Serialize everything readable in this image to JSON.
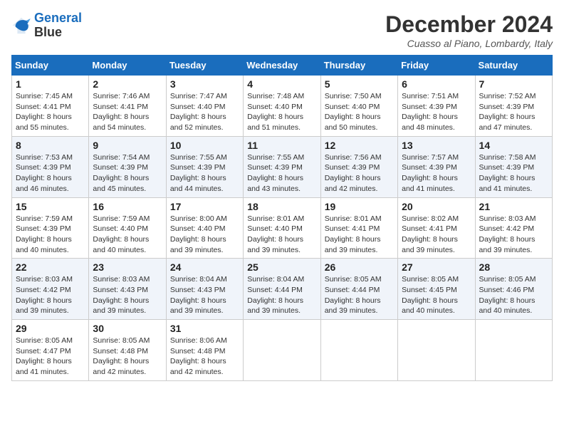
{
  "logo": {
    "line1": "General",
    "line2": "Blue"
  },
  "title": "December 2024",
  "location": "Cuasso al Piano, Lombardy, Italy",
  "headers": [
    "Sunday",
    "Monday",
    "Tuesday",
    "Wednesday",
    "Thursday",
    "Friday",
    "Saturday"
  ],
  "weeks": [
    [
      {
        "day": "1",
        "info": "Sunrise: 7:45 AM\nSunset: 4:41 PM\nDaylight: 8 hours\nand 55 minutes."
      },
      {
        "day": "2",
        "info": "Sunrise: 7:46 AM\nSunset: 4:41 PM\nDaylight: 8 hours\nand 54 minutes."
      },
      {
        "day": "3",
        "info": "Sunrise: 7:47 AM\nSunset: 4:40 PM\nDaylight: 8 hours\nand 52 minutes."
      },
      {
        "day": "4",
        "info": "Sunrise: 7:48 AM\nSunset: 4:40 PM\nDaylight: 8 hours\nand 51 minutes."
      },
      {
        "day": "5",
        "info": "Sunrise: 7:50 AM\nSunset: 4:40 PM\nDaylight: 8 hours\nand 50 minutes."
      },
      {
        "day": "6",
        "info": "Sunrise: 7:51 AM\nSunset: 4:39 PM\nDaylight: 8 hours\nand 48 minutes."
      },
      {
        "day": "7",
        "info": "Sunrise: 7:52 AM\nSunset: 4:39 PM\nDaylight: 8 hours\nand 47 minutes."
      }
    ],
    [
      {
        "day": "8",
        "info": "Sunrise: 7:53 AM\nSunset: 4:39 PM\nDaylight: 8 hours\nand 46 minutes."
      },
      {
        "day": "9",
        "info": "Sunrise: 7:54 AM\nSunset: 4:39 PM\nDaylight: 8 hours\nand 45 minutes."
      },
      {
        "day": "10",
        "info": "Sunrise: 7:55 AM\nSunset: 4:39 PM\nDaylight: 8 hours\nand 44 minutes."
      },
      {
        "day": "11",
        "info": "Sunrise: 7:55 AM\nSunset: 4:39 PM\nDaylight: 8 hours\nand 43 minutes."
      },
      {
        "day": "12",
        "info": "Sunrise: 7:56 AM\nSunset: 4:39 PM\nDaylight: 8 hours\nand 42 minutes."
      },
      {
        "day": "13",
        "info": "Sunrise: 7:57 AM\nSunset: 4:39 PM\nDaylight: 8 hours\nand 41 minutes."
      },
      {
        "day": "14",
        "info": "Sunrise: 7:58 AM\nSunset: 4:39 PM\nDaylight: 8 hours\nand 41 minutes."
      }
    ],
    [
      {
        "day": "15",
        "info": "Sunrise: 7:59 AM\nSunset: 4:39 PM\nDaylight: 8 hours\nand 40 minutes."
      },
      {
        "day": "16",
        "info": "Sunrise: 7:59 AM\nSunset: 4:40 PM\nDaylight: 8 hours\nand 40 minutes."
      },
      {
        "day": "17",
        "info": "Sunrise: 8:00 AM\nSunset: 4:40 PM\nDaylight: 8 hours\nand 39 minutes."
      },
      {
        "day": "18",
        "info": "Sunrise: 8:01 AM\nSunset: 4:40 PM\nDaylight: 8 hours\nand 39 minutes."
      },
      {
        "day": "19",
        "info": "Sunrise: 8:01 AM\nSunset: 4:41 PM\nDaylight: 8 hours\nand 39 minutes."
      },
      {
        "day": "20",
        "info": "Sunrise: 8:02 AM\nSunset: 4:41 PM\nDaylight: 8 hours\nand 39 minutes."
      },
      {
        "day": "21",
        "info": "Sunrise: 8:03 AM\nSunset: 4:42 PM\nDaylight: 8 hours\nand 39 minutes."
      }
    ],
    [
      {
        "day": "22",
        "info": "Sunrise: 8:03 AM\nSunset: 4:42 PM\nDaylight: 8 hours\nand 39 minutes."
      },
      {
        "day": "23",
        "info": "Sunrise: 8:03 AM\nSunset: 4:43 PM\nDaylight: 8 hours\nand 39 minutes."
      },
      {
        "day": "24",
        "info": "Sunrise: 8:04 AM\nSunset: 4:43 PM\nDaylight: 8 hours\nand 39 minutes."
      },
      {
        "day": "25",
        "info": "Sunrise: 8:04 AM\nSunset: 4:44 PM\nDaylight: 8 hours\nand 39 minutes."
      },
      {
        "day": "26",
        "info": "Sunrise: 8:05 AM\nSunset: 4:44 PM\nDaylight: 8 hours\nand 39 minutes."
      },
      {
        "day": "27",
        "info": "Sunrise: 8:05 AM\nSunset: 4:45 PM\nDaylight: 8 hours\nand 40 minutes."
      },
      {
        "day": "28",
        "info": "Sunrise: 8:05 AM\nSunset: 4:46 PM\nDaylight: 8 hours\nand 40 minutes."
      }
    ],
    [
      {
        "day": "29",
        "info": "Sunrise: 8:05 AM\nSunset: 4:47 PM\nDaylight: 8 hours\nand 41 minutes."
      },
      {
        "day": "30",
        "info": "Sunrise: 8:05 AM\nSunset: 4:48 PM\nDaylight: 8 hours\nand 42 minutes."
      },
      {
        "day": "31",
        "info": "Sunrise: 8:06 AM\nSunset: 4:48 PM\nDaylight: 8 hours\nand 42 minutes."
      },
      {
        "day": "",
        "info": ""
      },
      {
        "day": "",
        "info": ""
      },
      {
        "day": "",
        "info": ""
      },
      {
        "day": "",
        "info": ""
      }
    ]
  ]
}
